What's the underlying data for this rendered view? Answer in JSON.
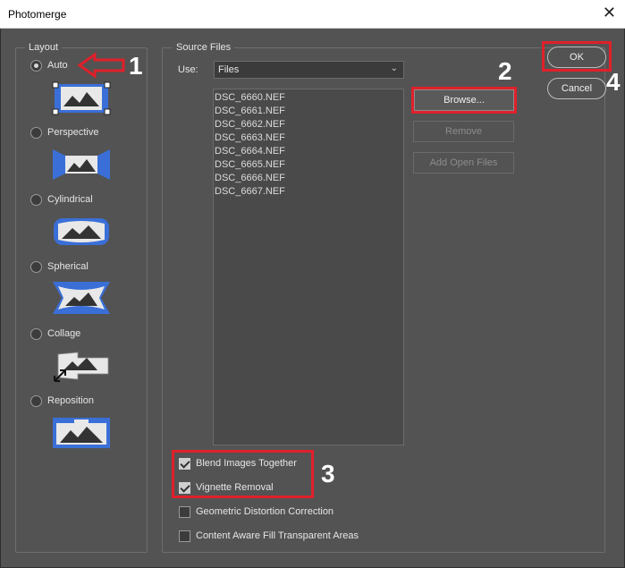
{
  "window": {
    "title": "Photomerge",
    "close_glyph": "✕"
  },
  "layout": {
    "label": "Layout",
    "selected": "Auto",
    "options": [
      {
        "label": "Auto",
        "checked": true
      },
      {
        "label": "Perspective",
        "checked": false
      },
      {
        "label": "Cylindrical",
        "checked": false
      },
      {
        "label": "Spherical",
        "checked": false
      },
      {
        "label": "Collage",
        "checked": false
      },
      {
        "label": "Reposition",
        "checked": false
      }
    ]
  },
  "source": {
    "label": "Source Files",
    "use_label": "Use:",
    "use_value": "Files",
    "files": [
      "DSC_6660.NEF",
      "DSC_6661.NEF",
      "DSC_6662.NEF",
      "DSC_6663.NEF",
      "DSC_6664.NEF",
      "DSC_6665.NEF",
      "DSC_6666.NEF",
      "DSC_6667.NEF"
    ],
    "browse_label": "Browse...",
    "remove_label": "Remove",
    "add_open_label": "Add Open Files"
  },
  "options": {
    "blend": {
      "label": "Blend Images Together",
      "checked": true
    },
    "vignette": {
      "label": "Vignette Removal",
      "checked": true
    },
    "geometric": {
      "label": "Geometric Distortion Correction",
      "checked": false
    },
    "content_aware": {
      "label": "Content Aware Fill Transparent Areas",
      "checked": false
    }
  },
  "buttons": {
    "ok": "OK",
    "cancel": "Cancel"
  },
  "annotations": {
    "n1": "1",
    "n2": "2",
    "n3": "3",
    "n4": "4"
  },
  "colors": {
    "highlight": "#e0202a",
    "accent_blue": "#3a6fd8",
    "dialog_bg": "#535353"
  }
}
